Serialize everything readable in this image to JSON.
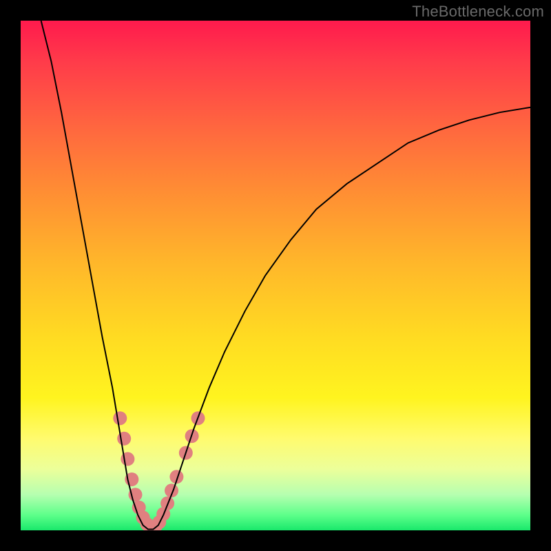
{
  "watermark": "TheBottleneck.com",
  "chart_data": {
    "type": "line",
    "title": "",
    "xlabel": "",
    "ylabel": "",
    "xlim": [
      0,
      100
    ],
    "ylim": [
      0,
      100
    ],
    "curve": {
      "name": "bottleneck-curve",
      "color": "#000000",
      "stroke_width": 2,
      "points_xy": [
        [
          4,
          100
        ],
        [
          6,
          92
        ],
        [
          8,
          82
        ],
        [
          10,
          71
        ],
        [
          12,
          60
        ],
        [
          14,
          49
        ],
        [
          16,
          38
        ],
        [
          18,
          28
        ],
        [
          19,
          22
        ],
        [
          20,
          16
        ],
        [
          21,
          10
        ],
        [
          22,
          6
        ],
        [
          23,
          3
        ],
        [
          24,
          1
        ],
        [
          25,
          0.2
        ],
        [
          26,
          0.2
        ],
        [
          27,
          1
        ],
        [
          28,
          3
        ],
        [
          30,
          8
        ],
        [
          32,
          14
        ],
        [
          34,
          20
        ],
        [
          37,
          28
        ],
        [
          40,
          35
        ],
        [
          44,
          43
        ],
        [
          48,
          50
        ],
        [
          53,
          57
        ],
        [
          58,
          63
        ],
        [
          64,
          68
        ],
        [
          70,
          72
        ],
        [
          76,
          76
        ],
        [
          82,
          78.5
        ],
        [
          88,
          80.5
        ],
        [
          94,
          82
        ],
        [
          100,
          83
        ]
      ]
    },
    "markers": {
      "name": "highlight-cluster",
      "color": "#e08080",
      "radius": 10,
      "points_xy": [
        [
          19.5,
          22
        ],
        [
          20.3,
          18
        ],
        [
          21.0,
          14
        ],
        [
          21.8,
          10
        ],
        [
          22.5,
          7
        ],
        [
          23.2,
          4.5
        ],
        [
          24.0,
          2.5
        ],
        [
          24.8,
          1.2
        ],
        [
          25.6,
          0.6
        ],
        [
          26.4,
          0.7
        ],
        [
          27.2,
          1.6
        ],
        [
          28.0,
          3.2
        ],
        [
          28.8,
          5.3
        ],
        [
          29.6,
          7.8
        ],
        [
          30.6,
          10.5
        ],
        [
          32.4,
          15.2
        ],
        [
          33.6,
          18.5
        ],
        [
          34.8,
          22
        ]
      ]
    }
  }
}
